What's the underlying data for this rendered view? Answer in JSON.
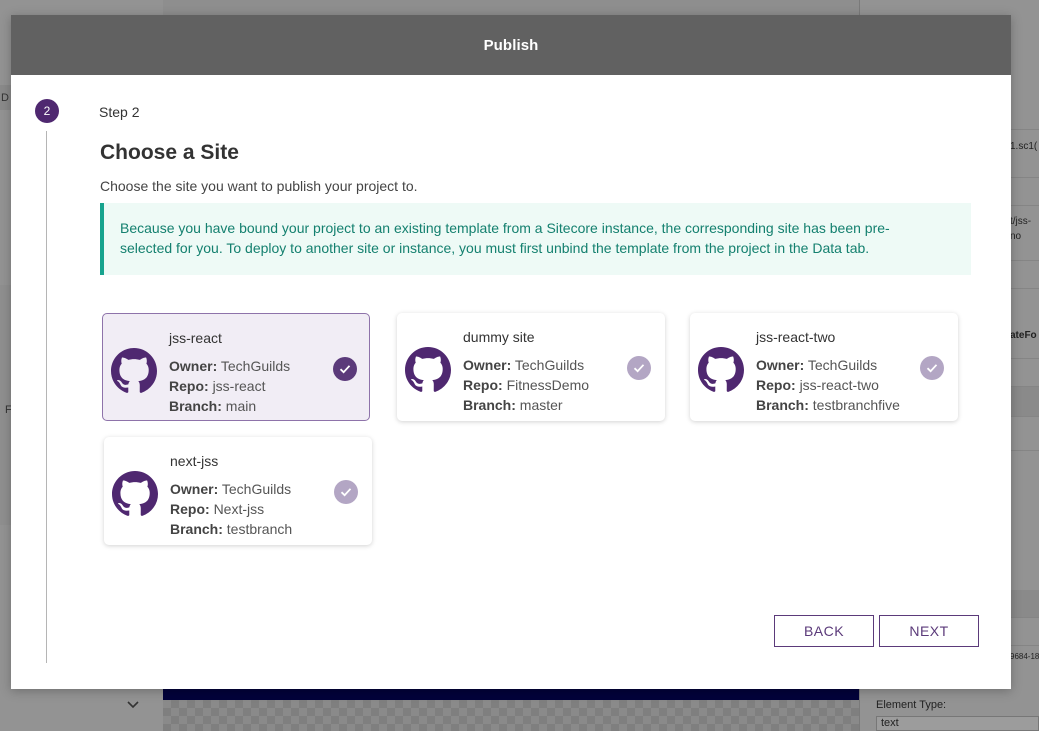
{
  "modal": {
    "title": "Publish",
    "step_number": "2",
    "step_label": "Step 2",
    "heading": "Choose a Site",
    "subheading": "Choose the site you want to publish your project to.",
    "notice_line1": "Because you have bound your project to an existing template from a Sitecore instance, the corresponding site has been pre-",
    "notice_line2": "selected for you. To deploy to another site or instance, you must first unbind the template from the project in the Data tab.",
    "owner_label": "Owner:",
    "repo_label": "Repo:",
    "branch_label": "Branch:",
    "sites": [
      {
        "name": "jss-react",
        "owner": "TechGuilds",
        "repo": "jss-react",
        "branch": "main",
        "selected": true
      },
      {
        "name": "dummy site",
        "owner": "TechGuilds",
        "repo": "FitnessDemo",
        "branch": "master",
        "selected": false
      },
      {
        "name": "jss-react-two",
        "owner": "TechGuilds",
        "repo": "jss-react-two",
        "branch": "testbranchfive",
        "selected": false
      },
      {
        "name": "next-jss",
        "owner": "TechGuilds",
        "repo": "Next-jss",
        "branch": "testbranch",
        "selected": false
      }
    ],
    "back_label": "BACK",
    "next_label": "NEXT"
  },
  "background": {
    "left_chars": [
      "D",
      "F"
    ],
    "right_texts": [
      "1.sc1(",
      "t/jss-",
      "no",
      "ateFo"
    ],
    "right_guid": "9684-18",
    "element_type_label": "Element Type:",
    "element_type_value": "text"
  },
  "colors": {
    "accent": "#5b3a7a",
    "header": "#616161",
    "notice_bg": "#eefaf6",
    "notice_border": "#17a38e",
    "notice_text": "#14806f",
    "selected_card_bg": "#f1edf5"
  },
  "icons": {
    "site_logo": "github-icon",
    "select_check": "check-circle-icon",
    "collapse": "chevron-down-icon"
  }
}
